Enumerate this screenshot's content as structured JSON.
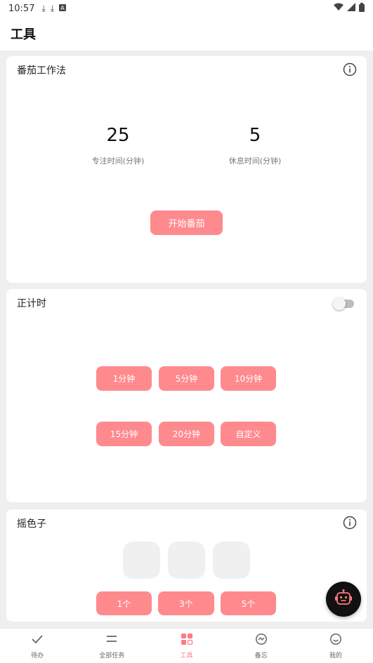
{
  "status_bar": {
    "time": "10:57",
    "left_icons": [
      "download-icon",
      "download-icon",
      "a-icon"
    ],
    "right_icons": [
      "wifi-icon",
      "signal-icon",
      "battery-icon"
    ]
  },
  "header": {
    "title": "工具"
  },
  "pomodoro": {
    "title": "番茄工作法",
    "focus_value": "25",
    "focus_label": "专注时间(分钟)",
    "rest_value": "5",
    "rest_label": "休息时间(分钟)",
    "start_button": "开始番茄"
  },
  "stopwatch": {
    "title": "正计时",
    "toggle_on": false,
    "buttons": [
      "1分钟",
      "5分钟",
      "10分钟",
      "15分钟",
      "20分钟",
      "自定义"
    ]
  },
  "dice": {
    "title": "摇色子",
    "buttons": [
      "1个",
      "3个",
      "5个"
    ]
  },
  "bottom_nav": {
    "items": [
      {
        "label": "待办",
        "icon": "check-icon"
      },
      {
        "label": "全部任务",
        "icon": "list-icon"
      },
      {
        "label": "工具",
        "icon": "grid-icon"
      },
      {
        "label": "备忘",
        "icon": "chat-icon"
      },
      {
        "label": "我的",
        "icon": "smile-icon"
      }
    ],
    "active_index": 2
  },
  "colors": {
    "accent": "#ff8a8e",
    "active_nav": "#ff7b82",
    "background": "#efefef",
    "card": "#ffffff",
    "fab": "#111111"
  }
}
